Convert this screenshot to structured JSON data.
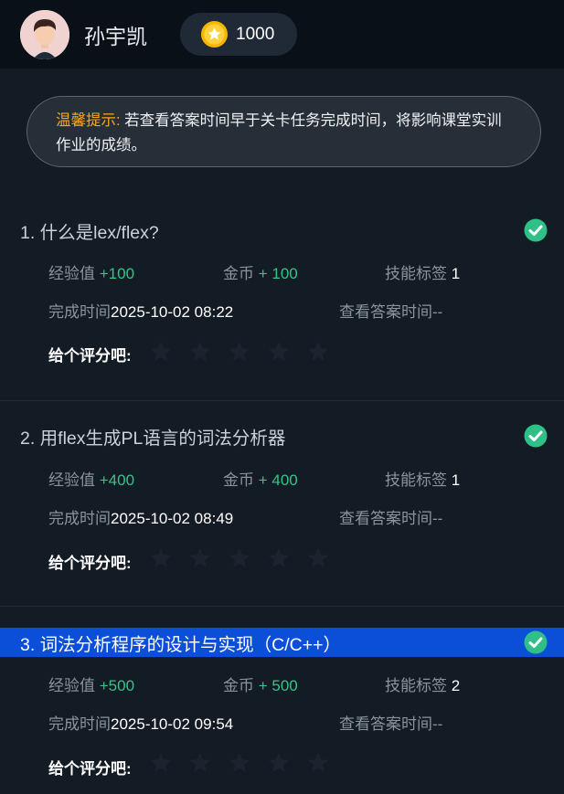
{
  "user": {
    "name": "孙宇凯",
    "coins": "1000"
  },
  "tip": {
    "label": "温馨提示:",
    "text": " 若查看答案时间早于关卡任务完成时间，将影响课堂实训作业的成绩。"
  },
  "labels": {
    "exp": "经验值",
    "coin": "金币",
    "skill": "技能标签",
    "done_time": "完成时间",
    "view_time": "查看答案时间",
    "rate": "给个评分吧:"
  },
  "tasks": [
    {
      "title": "1. 什么是lex/flex?",
      "exp": "+100",
      "coin": "+ 100",
      "skill": "1",
      "done_time": "2025-10-02 08:22",
      "view_time": "--"
    },
    {
      "title": "2. 用flex生成PL语言的词法分析器",
      "exp": "+400",
      "coin": "+ 400",
      "skill": "1",
      "done_time": "2025-10-02 08:49",
      "view_time": "--"
    },
    {
      "title": "3. 词法分析程序的设计与实现（C/C++）",
      "exp": "+500",
      "coin": "+ 500",
      "skill": "2",
      "done_time": "2025-10-02 09:54",
      "view_time": "--"
    }
  ],
  "colors": {
    "accent_green": "#34c48a",
    "warning": "#f5a623",
    "highlight": "#0b4fd9"
  }
}
